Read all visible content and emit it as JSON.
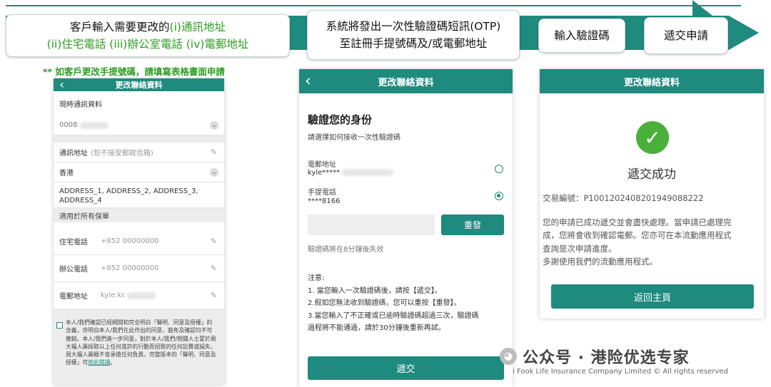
{
  "flow": {
    "step1_line1_a": "客戶輸入需要更改的",
    "step1_line1_b": "(i)通訊地址",
    "step1_line2": "(ii)住宅電話 (iii)辦公室電話 (iv)電郵地址",
    "step2_line1": "系統將發出一次性驗證碼短訊(OTP)",
    "step2_line2": "至註冊手提號碼及/或電郵地址",
    "step3": "輸入驗證碼",
    "step4": "遞交申請",
    "note": "** 如客戶更改手提號碼，請填寫表格書面申請"
  },
  "screen1": {
    "title": "更改聯絡資料",
    "current_section": "現時通訊資料",
    "current_value": "0008",
    "address_label": "通訊地址",
    "address_hint": "(恕不接受郵政信箱)",
    "region": "香港",
    "address_text": "ADDRESS_1, ADDRESS_2, ADDRESS_3, ADDRESS_4",
    "applies_all": "適用於所有保單",
    "home_phone_label": "住宅電話",
    "home_phone_value": "+852 00000000",
    "office_phone_label": "辦公電話",
    "office_phone_value": "+852 00000000",
    "email_label": "電郵地址",
    "email_value": "kyle.kc",
    "declaration": "本人/我們確認已經細閱和完全明白「聲明、同意及授權」的含義，亦明白本人/我們在此作出的同意、豁免及確認均不可撤銷。本人/我們進一步同意，對於本人/我們/相關人士蒙於周大福人壽採取以上任何准許的行動而招致的任何訟費或損失，周大福人壽概不會承擔任何負責。完整版本的「聲明、同意及授權」可",
    "declaration_link": "按此閱讀",
    "declaration_end": "。"
  },
  "screen2": {
    "title": "更改聯絡資料",
    "heading": "驗證您的身份",
    "sub": "請選擇如何接收一次性驗證碼",
    "email_label": "電郵地址",
    "email_value": "kyle*****",
    "mobile_label": "手提電話",
    "mobile_value": "****8166",
    "resend": "重發",
    "expiry": "驗證碼將在8分鐘後失效",
    "notes_title": "注意:",
    "note1": "1. 當您輸入一次驗證碼後，請按【遞交】。",
    "note2": "2.假如您無法收到驗證碼，您可以重按【重發】。",
    "note3a": "3.當您輸入了不正確或已逾時驗證碼超過三次，驗證碼",
    "note3b": "過程將不能通過，請於30分鐘後重新再試。",
    "submit": "遞交"
  },
  "screen3": {
    "title": "更改聯絡資料",
    "success": "遞交成功",
    "txn": "交易編號：P1001202408201949088222",
    "msg1": "您的申請已成功遞交並會盡快處理。當申請已處理完",
    "msg2": "成，您將會收到確認電郵。您亦可在本流動應用程式",
    "msg3": "查詢是次申請進度。",
    "msg4": "多謝使用我們的流動應用程式。",
    "home_btn": "返回主頁"
  },
  "footer": {
    "copyright": "i Fook Life Insurance Company Limited © All rights reserved",
    "watermark": "公众号 · 港险优选专家"
  },
  "colors": {
    "teal": "#1f8a7e",
    "green": "#2d9d22",
    "success_green": "#4aaf3b"
  }
}
